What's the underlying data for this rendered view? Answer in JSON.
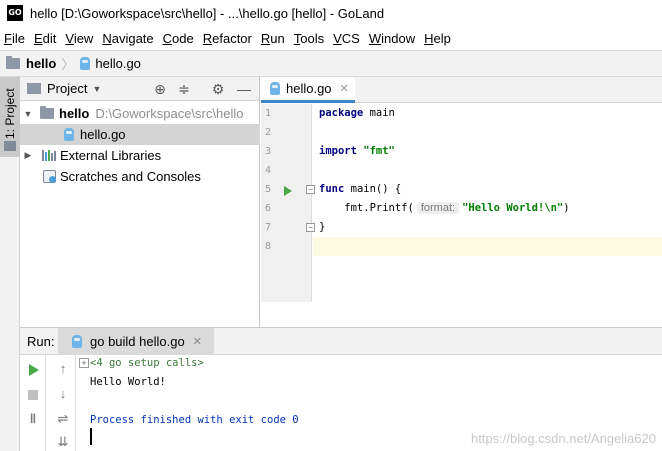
{
  "window": {
    "logo_text": "GO",
    "title": "hello [D:\\Goworkspace\\src\\hello] - ...\\hello.go [hello] - GoLand"
  },
  "menu": [
    {
      "mnemonic": "F",
      "rest": "ile"
    },
    {
      "mnemonic": "E",
      "rest": "dit"
    },
    {
      "mnemonic": "V",
      "rest": "iew"
    },
    {
      "mnemonic": "N",
      "rest": "avigate"
    },
    {
      "mnemonic": "C",
      "rest": "ode"
    },
    {
      "mnemonic": "R",
      "rest": "efactor"
    },
    {
      "mnemonic": "R",
      "rest": "un"
    },
    {
      "mnemonic": "T",
      "rest": "ools"
    },
    {
      "mnemonic": "V",
      "rest": "CS"
    },
    {
      "mnemonic": "W",
      "rest": "indow"
    },
    {
      "mnemonic": "H",
      "rest": "elp"
    }
  ],
  "breadcrumb": {
    "project": "hello",
    "file": "hello.go"
  },
  "left_strip": {
    "label": "1: Project"
  },
  "project_panel": {
    "title": "Project",
    "tree": {
      "root_name": "hello",
      "root_path": "D:\\Goworkspace\\src\\hello",
      "file": "hello.go",
      "external_libraries": "External Libraries",
      "scratches": "Scratches and Consoles"
    }
  },
  "editor": {
    "tab_label": "hello.go",
    "line_numbers": [
      "1",
      "2",
      "3",
      "4",
      "5",
      "6",
      "7",
      "8"
    ],
    "code": {
      "line1_kw": "package",
      "line1_id": " main",
      "line3_kw": "import",
      "line3_str": "\"fmt\"",
      "line5_kw": "func",
      "line5_id": " main() {",
      "line6_pre": "    fmt.Printf(",
      "line6_hint": "format:",
      "line6_str": "\"Hello World!\\n\"",
      "line6_post": ")",
      "line7": "}"
    }
  },
  "run_panel": {
    "label": "Run:",
    "tab_label": "go build hello.go",
    "console": {
      "collapsed": "<4 go setup calls>",
      "output": "Hello World!",
      "process": "Process finished with exit code 0"
    }
  },
  "watermark": "https://blog.csdn.net/Angelia620",
  "colors": {
    "run_green": "#49a748",
    "keyword": "#000080",
    "string": "#008000",
    "tab_underline": "#4083c9",
    "current_line": "#fcfae1"
  }
}
